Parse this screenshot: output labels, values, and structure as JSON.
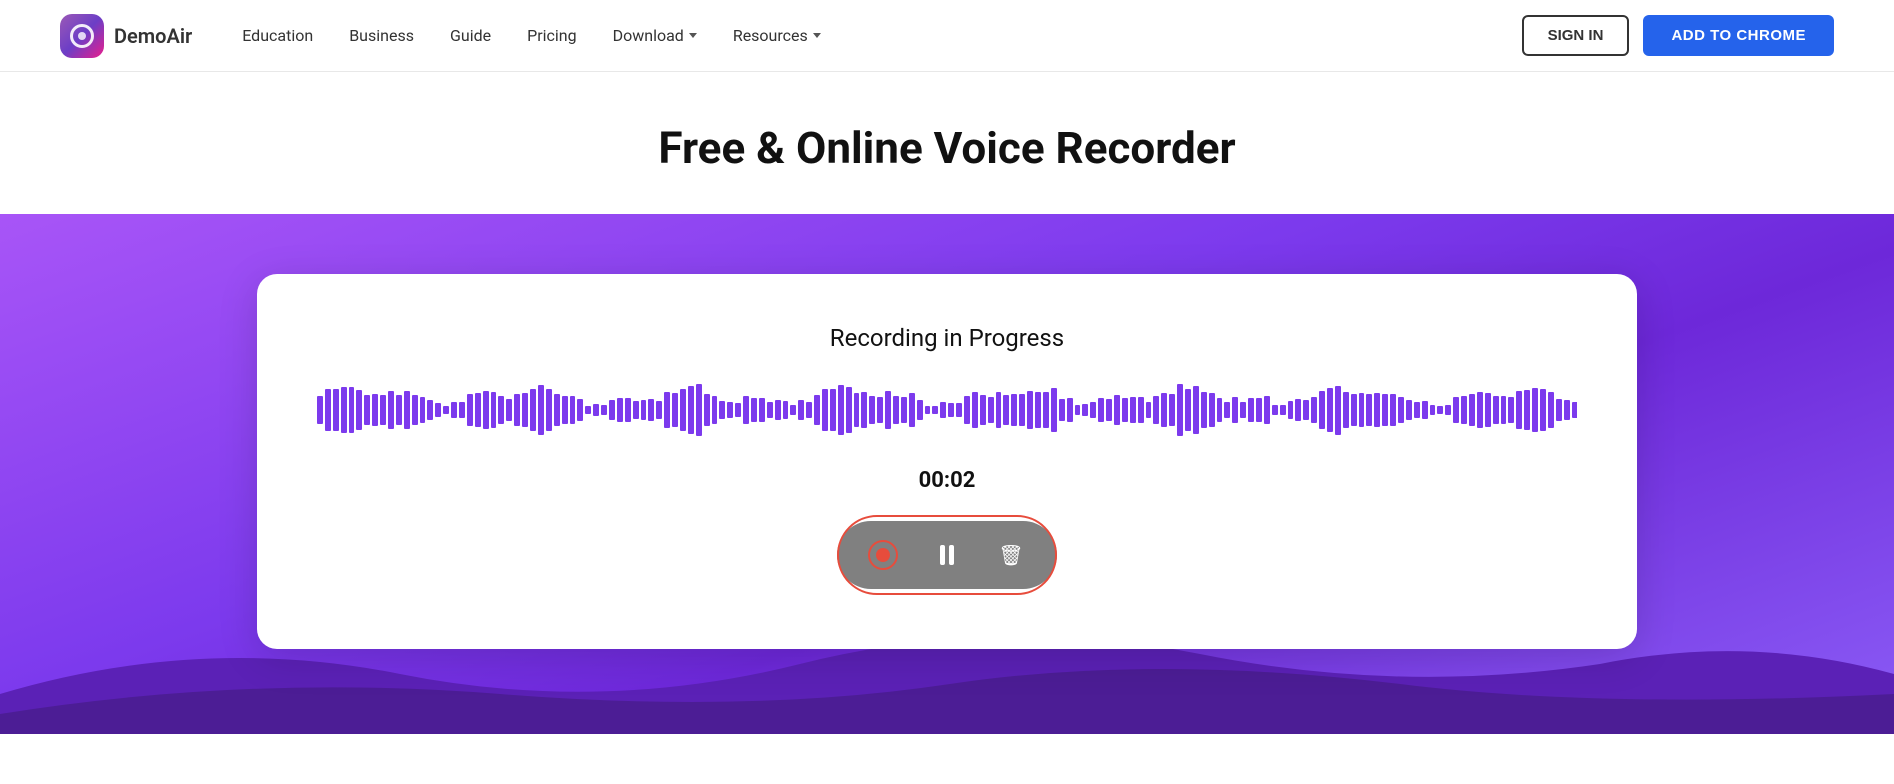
{
  "nav": {
    "logo_text": "DemoAir",
    "links": [
      {
        "label": "Education",
        "has_arrow": false
      },
      {
        "label": "Business",
        "has_arrow": false
      },
      {
        "label": "Guide",
        "has_arrow": false
      },
      {
        "label": "Pricing",
        "has_arrow": false
      },
      {
        "label": "Download",
        "has_arrow": true
      },
      {
        "label": "Resources",
        "has_arrow": true
      }
    ],
    "sign_in_label": "SIGN IN",
    "add_chrome_label": "ADD TO CHROME"
  },
  "hero": {
    "title": "Free & Online Voice Recorder"
  },
  "recorder": {
    "status": "Recording in Progress",
    "timer": "00:02",
    "controls": {
      "stop_aria": "Stop recording",
      "pause_aria": "Pause recording",
      "delete_aria": "Delete recording"
    }
  }
}
